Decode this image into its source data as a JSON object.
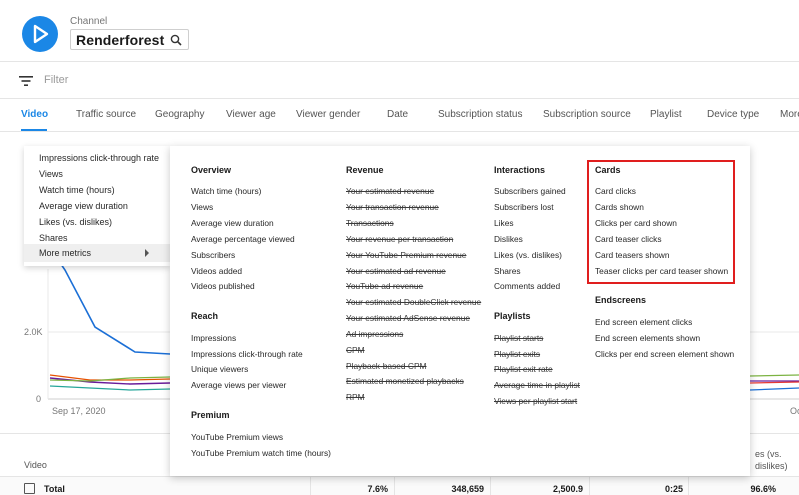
{
  "header": {
    "channel_label": "Channel",
    "channel_name": "Renderforest",
    "brand_color": "#1b87e6"
  },
  "filter": {
    "placeholder": "Filter"
  },
  "tabs": [
    {
      "label": "Video"
    },
    {
      "label": "Traffic source"
    },
    {
      "label": "Geography"
    },
    {
      "label": "Viewer age"
    },
    {
      "label": "Viewer gender"
    },
    {
      "label": "Date"
    },
    {
      "label": "Subscription status"
    },
    {
      "label": "Subscription source"
    },
    {
      "label": "Playlist"
    },
    {
      "label": "Device type"
    },
    {
      "label": "More"
    }
  ],
  "chart": {
    "y_labels": [
      "2.0K",
      "0"
    ],
    "x_label_start": "Sep 17, 2020",
    "x_label_end": "Oc"
  },
  "left_menu": {
    "items": [
      "Impressions click-through rate",
      "Views",
      "Watch time (hours)",
      "Average view duration",
      "Likes (vs. dislikes)",
      "Shares"
    ],
    "more_label": "More metrics"
  },
  "panel": {
    "overview": {
      "title": "Overview",
      "items": [
        "Watch time (hours)",
        "Views",
        "Average view duration",
        "Average percentage viewed",
        "Subscribers",
        "Videos added",
        "Videos published"
      ]
    },
    "reach": {
      "title": "Reach",
      "items": [
        "Impressions",
        "Impressions click-through rate",
        "Unique viewers",
        "Average views per viewer"
      ]
    },
    "premium": {
      "title": "Premium",
      "items": [
        "YouTube Premium views",
        "YouTube Premium watch time (hours)"
      ]
    },
    "revenue": {
      "title": "Revenue",
      "items": [
        "Your estimated revenue",
        "Your transaction revenue",
        "Transactions",
        "Your revenue per transaction",
        "Your YouTube Premium revenue",
        "Your estimated ad revenue",
        "YouTube ad revenue",
        "Your estimated DoubleClick revenue",
        "Your estimated AdSense revenue",
        "Ad impressions",
        "CPM",
        "Playback-based CPM",
        "Estimated monetized playbacks",
        "RPM"
      ]
    },
    "interactions": {
      "title": "Interactions",
      "items": [
        "Subscribers gained",
        "Subscribers lost",
        "Likes",
        "Dislikes",
        "Likes (vs. dislikes)",
        "Shares",
        "Comments added"
      ]
    },
    "playlists": {
      "title": "Playlists",
      "items": [
        "Playlist starts",
        "Playlist exits",
        "Playlist exit rate",
        "Average time in playlist",
        "Views per playlist start"
      ]
    },
    "cards": {
      "title": "Cards",
      "items": [
        "Card clicks",
        "Cards shown",
        "Clicks per card shown",
        "Card teaser clicks",
        "Card teasers shown",
        "Teaser clicks per card teaser shown"
      ]
    },
    "endscreens": {
      "title": "Endscreens",
      "items": [
        "End screen element clicks",
        "End screen elements shown",
        "Clicks per end screen element shown"
      ]
    },
    "highlight_color": "#e01e1e"
  },
  "table": {
    "header_video": "Video",
    "header_right_1": "es (vs.",
    "header_right_2": "dislikes)",
    "total_label": "Total",
    "total_values": [
      "7.6%",
      "348,659",
      "2,500.9",
      "0:25",
      "96.6%"
    ]
  }
}
